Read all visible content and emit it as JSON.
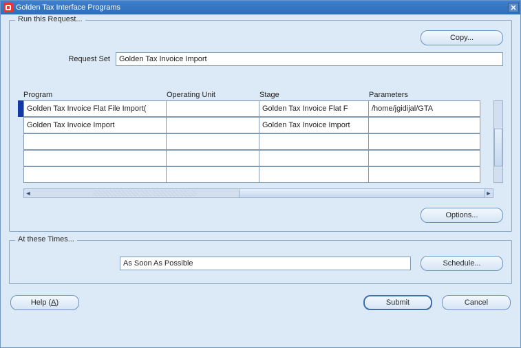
{
  "window": {
    "title": "Golden Tax Interface Programs"
  },
  "frame1": {
    "title": "Run this Request...",
    "copy_label": "Copy...",
    "request_set_label": "Request Set",
    "request_set_value": "Golden Tax Invoice Import",
    "options_label": "Options...",
    "columns": {
      "program": "Program",
      "opunit": "Operating Unit",
      "stage": "Stage",
      "params": "Parameters"
    },
    "rows": [
      {
        "program": "Golden Tax Invoice Flat File Import(",
        "opunit": "",
        "stage": "Golden Tax Invoice Flat F",
        "params": "/home/jgidijal/GTA"
      },
      {
        "program": "Golden Tax Invoice Import",
        "opunit": "",
        "stage": "Golden Tax Invoice Import",
        "params": ""
      },
      {
        "program": "",
        "opunit": "",
        "stage": "",
        "params": ""
      },
      {
        "program": "",
        "opunit": "",
        "stage": "",
        "params": ""
      },
      {
        "program": "",
        "opunit": "",
        "stage": "",
        "params": ""
      }
    ]
  },
  "frame2": {
    "title": "At these Times...",
    "value": "As Soon As Possible",
    "schedule_label": "Schedule..."
  },
  "buttons": {
    "help_prefix": "Help (",
    "help_key": "A",
    "help_suffix": ")",
    "submit": "Submit",
    "cancel": "Cancel"
  }
}
